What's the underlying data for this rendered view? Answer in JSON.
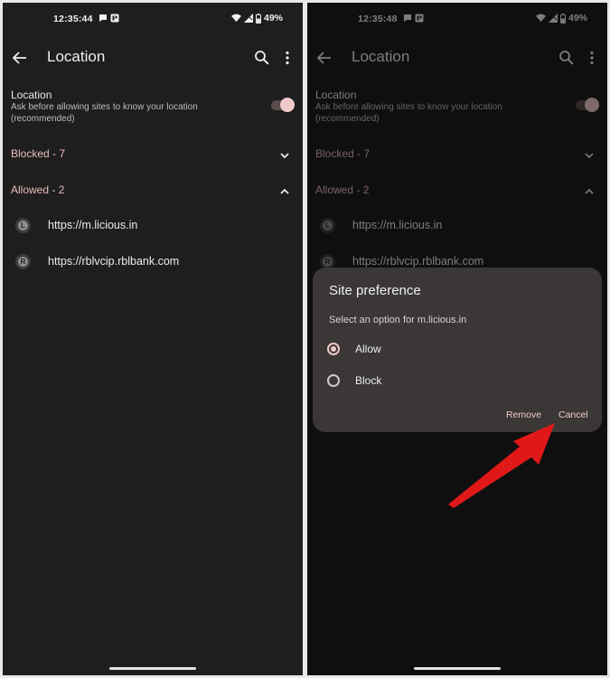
{
  "left": {
    "status": {
      "time": "12:35:44",
      "battery": "49%"
    },
    "appbar": {
      "title": "Location"
    },
    "setting": {
      "title": "Location",
      "description": "Ask before allowing sites to know your location (recommended)",
      "toggle_on": true
    },
    "blocked": {
      "label": "Blocked - 7"
    },
    "allowed": {
      "label": "Allowed - 2"
    },
    "sites": [
      {
        "letter": "L",
        "url": "https://m.licious.in"
      },
      {
        "letter": "R",
        "url": "https://rblvcip.rblbank.com"
      }
    ]
  },
  "right": {
    "status": {
      "time": "12:35:48",
      "battery": "49%"
    },
    "appbar": {
      "title": "Location"
    },
    "setting": {
      "title": "Location",
      "description": "Ask before allowing sites to know your location (recommended)",
      "toggle_on": true
    },
    "blocked": {
      "label": "Blocked - 7"
    },
    "allowed": {
      "label": "Allowed - 2"
    },
    "sites": [
      {
        "letter": "L",
        "url": "https://m.licious.in"
      },
      {
        "letter": "R",
        "url": "https://rblvcip.rblbank.com"
      }
    ],
    "dialog": {
      "title": "Site preference",
      "subtitle": "Select an option for m.licious.in",
      "options": [
        {
          "label": "Allow",
          "selected": true
        },
        {
          "label": "Block",
          "selected": false
        }
      ],
      "remove_label": "Remove",
      "cancel_label": "Cancel"
    }
  },
  "colors": {
    "background": "#1f1e1e",
    "accent": "#e9bcbc",
    "dialog": "#3b3737",
    "arrow": "#e01818"
  },
  "icons": [
    "back-arrow-icon",
    "search-icon",
    "more-vert-icon",
    "wifi-icon",
    "signal-icon",
    "battery-icon",
    "chevron-down-icon",
    "chevron-up-icon",
    "annotation-arrow-icon"
  ]
}
